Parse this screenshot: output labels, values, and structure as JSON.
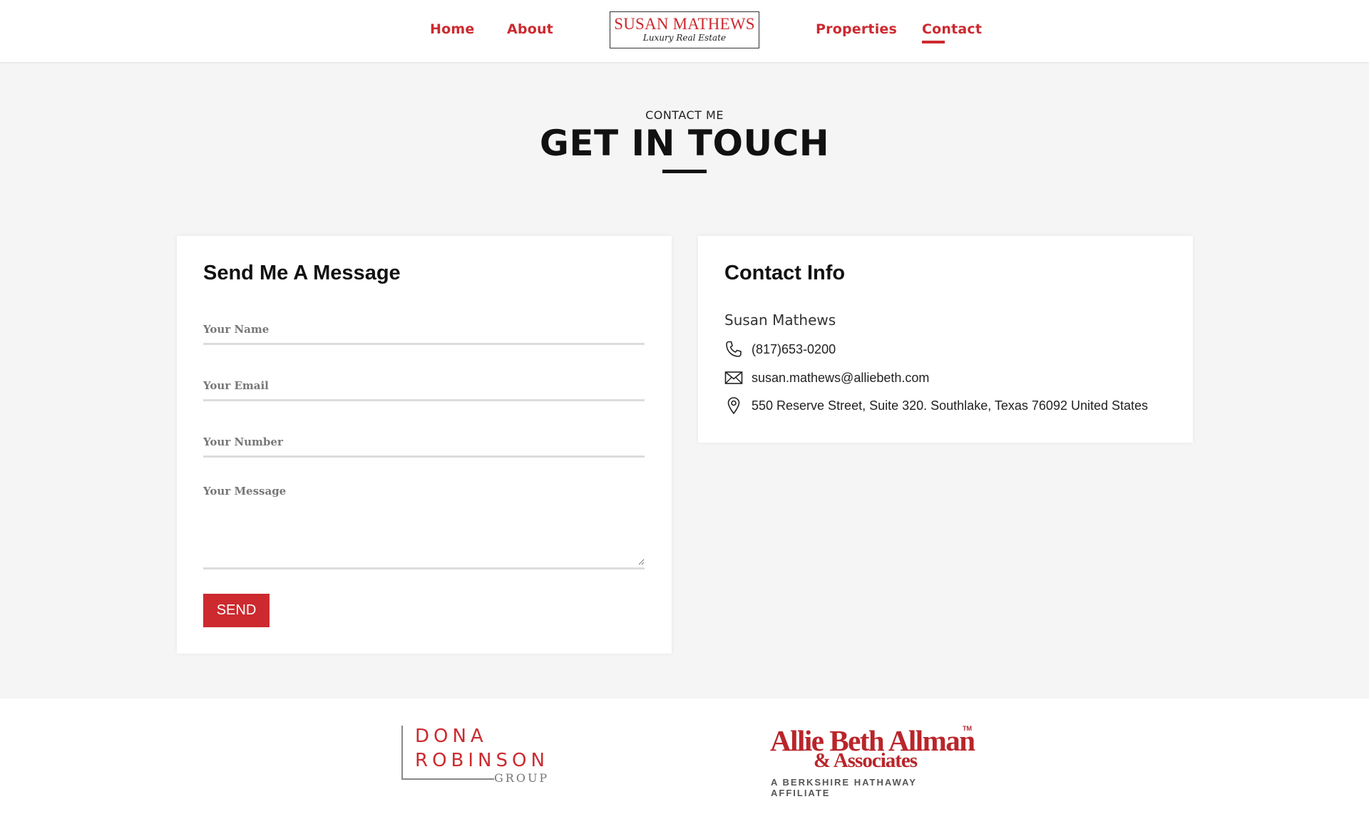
{
  "nav": {
    "items": [
      {
        "label": "Home"
      },
      {
        "label": "About"
      },
      {
        "label": "Properties"
      },
      {
        "label": "Contact"
      }
    ],
    "active": "Contact"
  },
  "logo": {
    "main": "SUSAN MATHEWS",
    "sub": "Luxury Real Estate"
  },
  "hero": {
    "eyebrow": "CONTACT ME",
    "title": "GET IN TOUCH"
  },
  "form": {
    "title": "Send Me A Message",
    "name_placeholder": "Your Name",
    "email_placeholder": "Your Email",
    "number_placeholder": "Your Number",
    "message_placeholder": "Your Message",
    "send_label": "SEND"
  },
  "contact_info": {
    "title": "Contact Info",
    "name": "Susan Mathews",
    "phone": "(817)653-0200",
    "email": "susan.mathews@alliebeth.com",
    "address": "550 Reserve Street, Suite 320. Southlake, Texas 76092 United States"
  },
  "footer": {
    "dona_line1": "DONA",
    "dona_line2": "ROBINSON",
    "dona_line3": "GROUP",
    "abaa_line1": "Allie Beth Allman",
    "abaa_tm": "TM",
    "abaa_line2": "& Associates",
    "abaa_line3": "A BERKSHIRE HATHAWAY AFFILIATE"
  },
  "colors": {
    "accent": "#cc2a2f",
    "background": "#f5f5f5",
    "card": "#ffffff"
  },
  "icons": [
    "phone-icon",
    "envelope-icon",
    "map-pin-icon"
  ]
}
